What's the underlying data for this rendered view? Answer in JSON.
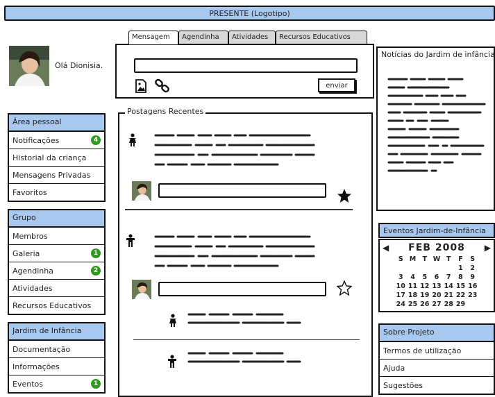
{
  "topbar": {
    "title": "PRESENTE (Logotipo)"
  },
  "user": {
    "greeting": "Olá Dionisia."
  },
  "tabs": [
    {
      "label": "Mensagem"
    },
    {
      "label": "Agendinha"
    },
    {
      "label": "Atividades"
    },
    {
      "label": "Recursos Educativos"
    }
  ],
  "compose": {
    "send_label": "enviar"
  },
  "sidebar": {
    "pessoal": {
      "title": "Área pessoal",
      "items": [
        {
          "label": "Notificações",
          "badge": "4"
        },
        {
          "label": "Historial da criança",
          "badge": ""
        },
        {
          "label": "Mensagens Privadas",
          "badge": ""
        },
        {
          "label": "Favoritos",
          "badge": ""
        }
      ]
    },
    "grupo": {
      "title": "Grupo",
      "items": [
        {
          "label": "Membros",
          "badge": ""
        },
        {
          "label": "Galeria",
          "badge": "1"
        },
        {
          "label": "Agendinha",
          "badge": "2"
        },
        {
          "label": "Atividades",
          "badge": ""
        },
        {
          "label": "Recursos Educativos",
          "badge": ""
        }
      ]
    },
    "jardim": {
      "title": "Jardim de Infância",
      "items": [
        {
          "label": "Documentação",
          "badge": ""
        },
        {
          "label": "Informações",
          "badge": ""
        },
        {
          "label": "Eventos",
          "badge": "1"
        }
      ]
    }
  },
  "posts": {
    "legend": "Postagens Recentes"
  },
  "news": {
    "title": "Notícias do Jardim de infância"
  },
  "events": {
    "title": "Eventos Jardim-de-Infância",
    "calendar": {
      "month": "FEB 2008",
      "weekdays": [
        "S",
        "M",
        "T",
        "W",
        "T",
        "F",
        "S"
      ],
      "weeks": [
        [
          "",
          "",
          "",
          "",
          "",
          "1",
          "2"
        ],
        [
          "3",
          "4",
          "5",
          "6",
          "7",
          "8",
          "9"
        ],
        [
          "10",
          "11",
          "12",
          "13",
          "14",
          "15",
          "16"
        ],
        [
          "17",
          "18",
          "19",
          "20",
          "21",
          "22",
          "23"
        ],
        [
          "24",
          "25",
          "26",
          "27",
          "28",
          "29",
          ""
        ]
      ]
    }
  },
  "about": {
    "title": "Sobre Projeto",
    "items": [
      {
        "label": "Termos de utilização"
      },
      {
        "label": "Ajuda"
      },
      {
        "label": "Sugestões"
      }
    ]
  }
}
